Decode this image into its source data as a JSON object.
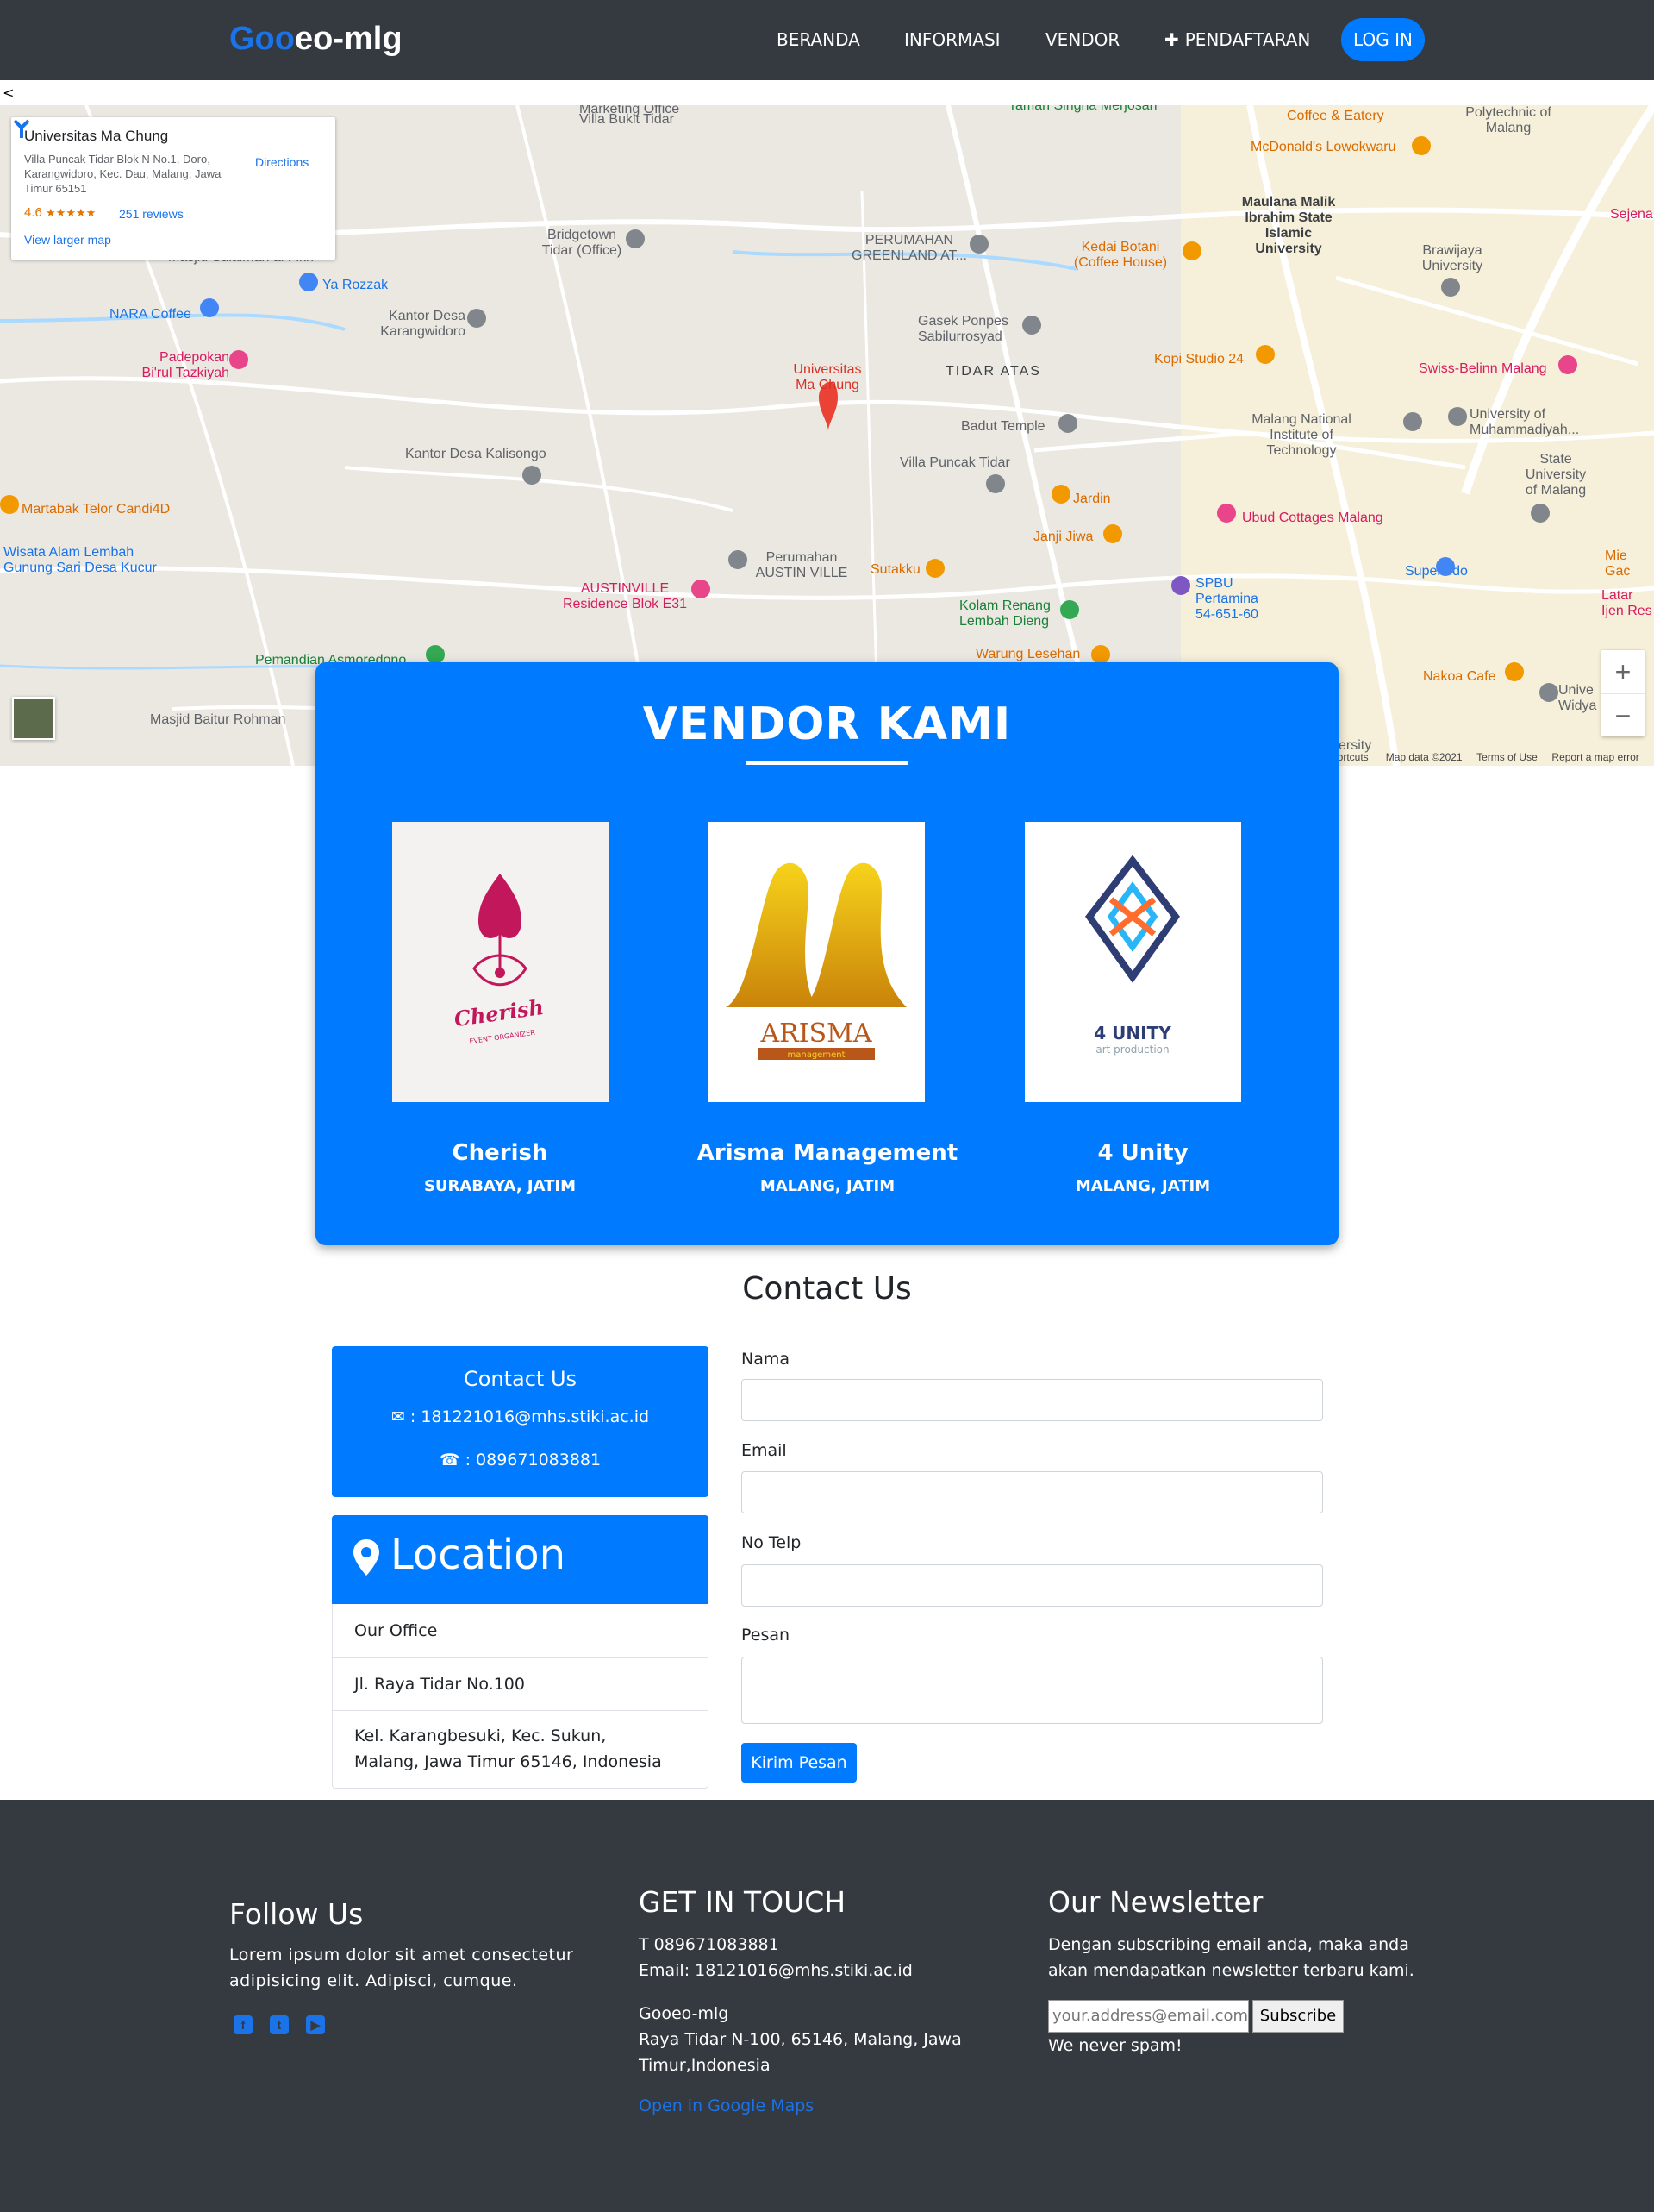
{
  "navbar": {
    "brand_part1": "Goo",
    "brand_part2": "eo-mlg",
    "links": [
      "BERANDA",
      "INFORMASI",
      "VENDOR",
      "PENDAFTARAN"
    ],
    "login": "LOG IN"
  },
  "stray_char": "<",
  "map": {
    "card": {
      "title": "Universitas Ma Chung",
      "address": "Villa Puncak Tidar Blok N No.1, Doro, Karangwidoro, Kec. Dau, Malang, Jawa Timur 65151",
      "rating": "4.6",
      "stars": "★★★★★",
      "reviews": "251 reviews",
      "larger_map": "View larger map",
      "directions": "Directions"
    },
    "labels": {
      "marketing": "Marketing Office",
      "villa_bukit": "Villa Bukit Tidar",
      "taman_singha": "Taman Singha Merjosari",
      "masjid_sulaiman": "Masjid Sulaiman al Fikri",
      "bridgetown": "Bridgetown Tidar (Office)",
      "perumahan_greenland": "PERUMAHAN GREENLAND AT...",
      "ya_rozzak": "Ya Rozzak",
      "nara": "NARA Coffee",
      "kantor_karangwidoro": "Kantor Desa Karangwidoro",
      "padepokan": "Padepokan Bi'rul Tazkiyah",
      "univ_machung": "Universitas Ma Chung",
      "gasek": "Gasek Ponpes Sabilurrosyad",
      "tidar_atas": "TIDAR ATAS",
      "badut": "Badut Temple",
      "kantor_kalisongo": "Kantor Desa Kalisongo",
      "villa_puncak": "Villa Puncak Tidar",
      "martabak": "Martabak Telor Candi4D",
      "wisata": "Wisata Alam Lembah Gunung Sari Desa Kucur",
      "perumahan_austin": "Perumahan AUSTIN VILLE",
      "austinville": "AUSTINVILLE Residence Blok E31",
      "sutakku": "Sutakku",
      "kolam": "Kolam Renang Lembah Dieng",
      "pemandian": "Pemandian Asmoredono",
      "warung": "Warung Lesehan",
      "masjid_baitur": "Masjid Baitur Rohman",
      "coffee_eatery": "Coffee & Eatery",
      "mcd": "McDonald's Lowokwaru",
      "polytechnic": "Polytechnic of Malang",
      "maulana": "Maulana Malik Ibrahim State Islamic University",
      "kedai": "Kedai Botani (Coffee House)",
      "brawijaya": "Brawijaya University",
      "kopi": "Kopi Studio 24",
      "swiss": "Swiss-Belinn Malang",
      "malang_national": "Malang National Institute of Technology",
      "umm": "University of Muhammadiyah...",
      "state_univ": "State University of Malang",
      "jardin": "Jardin",
      "ubud": "Ubud Cottages Malang",
      "janji": "Janji Jiwa",
      "superindo": "Superindo",
      "spbu": "SPBU Pertamina 54-651-60",
      "nakoa": "Nakoa Cafe",
      "sejena": "Sejena",
      "mie": "Mie Gac",
      "latar": "Latar Ijen Res",
      "univ_widya": "Unive Widya",
      "ersity": "ersity"
    },
    "footer": {
      "shortcuts": "hortcuts",
      "mapdata": "Map data ©2021",
      "terms": "Terms of Use",
      "report": "Report a map error"
    },
    "zoom_in": "+",
    "zoom_out": "−"
  },
  "vendors": {
    "title": "VENDOR KAMI",
    "items": [
      {
        "name": "Cherish",
        "city": "SURABAYA, JATIM",
        "logo_text": "Cherish",
        "logo_sub": "EVENT ORGANIZER"
      },
      {
        "name": "Arisma Management",
        "city": "MALANG, JATIM",
        "logo_text": "ARISMA",
        "logo_sub": "management"
      },
      {
        "name": "4 Unity",
        "city": "MALANG, JATIM",
        "logo_text": "4 UNITY",
        "logo_sub": "art production"
      }
    ]
  },
  "contact": {
    "heading": "Contact Us",
    "box_title": "Contact Us",
    "email": ": 181221016@mhs.stiki.ac.id",
    "phone": ": 089671083881",
    "location_title": "Location",
    "location_rows": [
      "Our Office",
      "Jl. Raya Tidar No.100",
      "Kel. Karangbesuki, Kec. Sukun, Malang, Jawa Timur 65146, Indonesia"
    ],
    "form": {
      "nama": "Nama",
      "email": "Email",
      "telp": "No Telp",
      "pesan": "Pesan",
      "submit": "Kirim Pesan"
    }
  },
  "footer": {
    "follow_title": "Follow Us",
    "follow_text": "Lorem ipsum dolor sit amet consectetur adipisicing elit. Adipisci, cumque.",
    "social": [
      "facebook-icon",
      "twitter-icon",
      "youtube-icon"
    ],
    "git_title": "GET IN TOUCH",
    "phone": "T 089671083881",
    "email": "Email: 18121016@mhs.stiki.ac.id",
    "company": "Gooeo-mlg",
    "address": "Raya Tidar N-100, 65146, Malang, Jawa Timur,Indonesia",
    "maps_link": "Open in Google Maps",
    "nl_title": "Our Newsletter",
    "nl_text": "Dengan subscribing email anda, maka anda akan mendapatkan newsletter terbaru kami.",
    "nl_placeholder": "your.address@email.com",
    "nl_button": "Subscribe",
    "nl_note": "We never spam!"
  },
  "colors": {
    "primary": "#007bff",
    "dark": "#343a40",
    "link": "#1a73e8"
  }
}
